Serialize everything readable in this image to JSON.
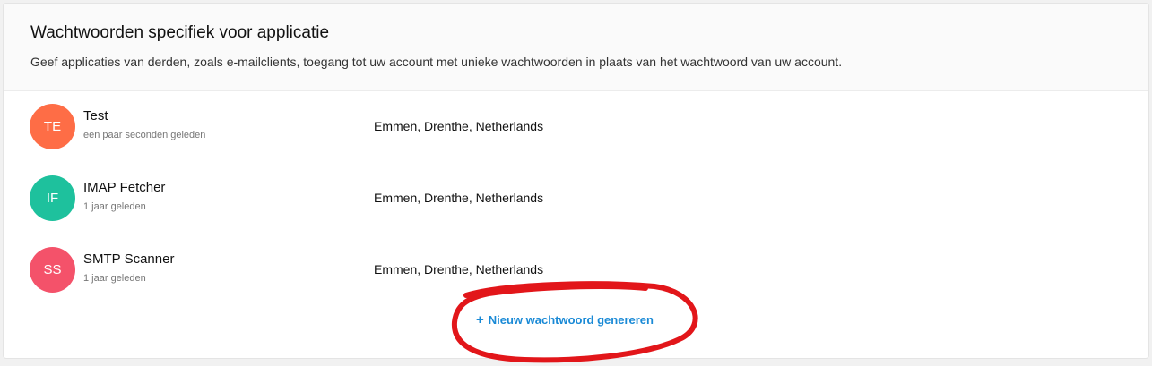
{
  "section": {
    "title": "Wachtwoorden specifiek voor applicatie",
    "description": "Geef applicaties van derden, zoals e-mailclients, toegang tot uw account met unieke wachtwoorden in plaats van het wachtwoord van uw account."
  },
  "passwords": [
    {
      "initials": "TE",
      "name": "Test",
      "created": "een paar seconden geleden",
      "location": "Emmen, Drenthe, Netherlands",
      "avatar_color": "#fe6d46"
    },
    {
      "initials": "IF",
      "name": "IMAP Fetcher",
      "created": "1 jaar geleden",
      "location": "Emmen, Drenthe, Netherlands",
      "avatar_color": "#1ec19d"
    },
    {
      "initials": "SS",
      "name": "SMTP Scanner",
      "created": "1 jaar geleden",
      "location": "Emmen, Drenthe, Netherlands",
      "avatar_color": "#f4526a"
    }
  ],
  "actions": {
    "generate_label": "Nieuw wachtwoord genereren",
    "generate_icon": "plus-icon"
  },
  "colors": {
    "link": "#1a8ad6",
    "annotation": "#e2161a"
  }
}
